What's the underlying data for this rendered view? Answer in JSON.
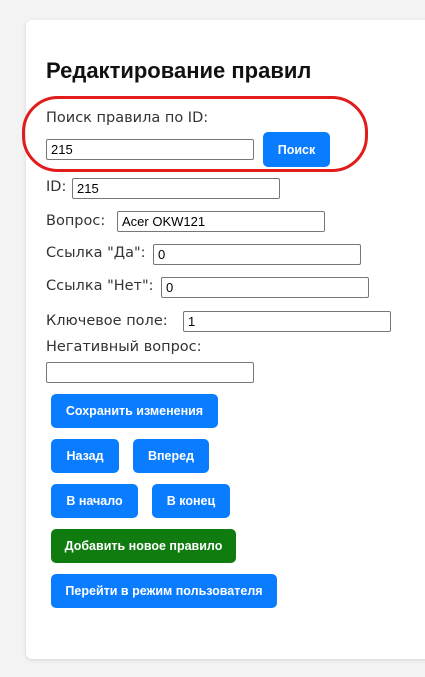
{
  "page": {
    "title": "Редактирование правил"
  },
  "search": {
    "label": "Поиск правила по ID:",
    "value": "215",
    "button_label": "Поиск"
  },
  "form": {
    "id_label": "ID:",
    "id_value": "215",
    "question_label": "Вопрос:",
    "question_value": "Acer OKW121",
    "yes_link_label": "Ссылка \"Да\":",
    "yes_link_value": "0",
    "no_link_label": "Ссылка \"Нет\":",
    "no_link_value": "0",
    "key_field_label": "Ключевое поле:",
    "key_field_value": "1",
    "negative_question_label": "Негативный вопрос:",
    "negative_question_value": ""
  },
  "buttons": {
    "save": "Сохранить изменения",
    "back": "Назад",
    "forward": "Вперед",
    "to_start": "В начало",
    "to_end": "В конец",
    "add_rule": "Добавить новое правило",
    "user_mode": "Перейти в режим пользователя"
  },
  "colors": {
    "primary_button": "#0a7cff",
    "add_button": "#107c10",
    "highlight_outline": "#e21b1b"
  }
}
